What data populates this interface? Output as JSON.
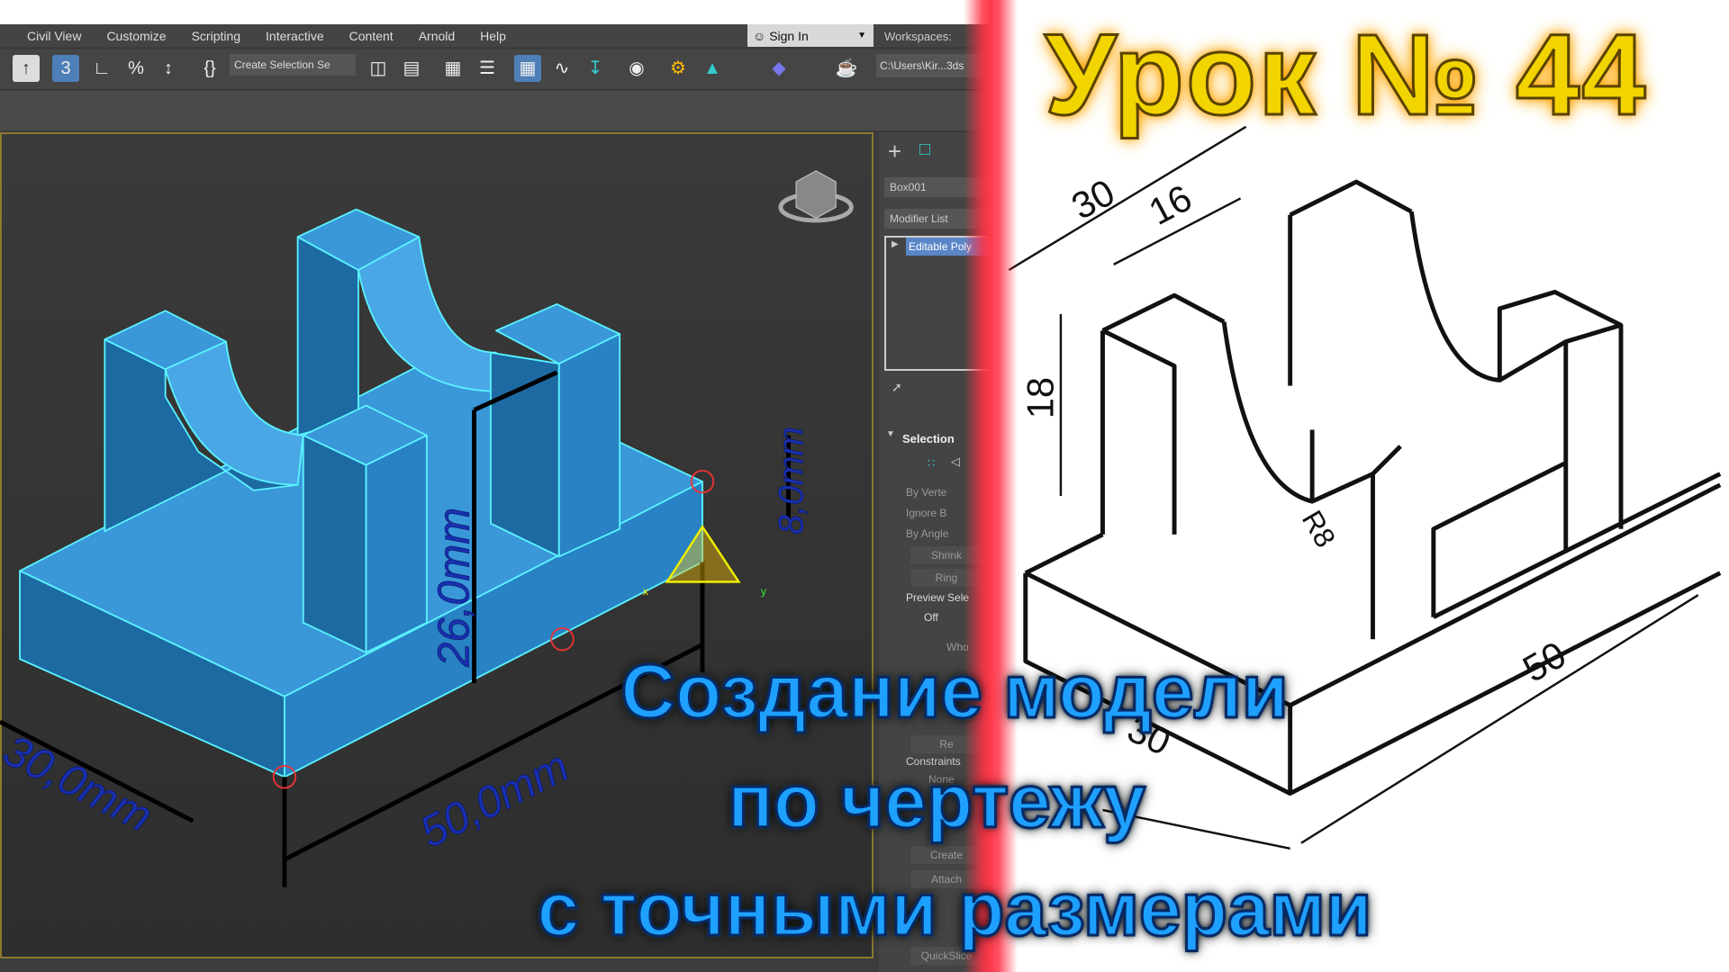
{
  "menu": {
    "items": [
      "Civil View",
      "Customize",
      "Scripting",
      "Interactive",
      "Content",
      "Arnold",
      "Help"
    ],
    "sign_in": "Sign In",
    "workspaces": "Workspaces:"
  },
  "toolbar": {
    "selection_set": "Create Selection Se",
    "path": "C:\\Users\\Kir...3ds"
  },
  "command_panel": {
    "object_name": "Box001",
    "modifier_list": "Modifier List",
    "modifier": "Editable Poly",
    "rollout": "Selection",
    "checkboxes": [
      "By Verte",
      "Ignore B",
      "By Angle"
    ],
    "buttons": [
      "Shrink",
      "Ring"
    ],
    "preview_label": "Preview Sele",
    "preview_value": "Off",
    "whole": "Who",
    "constraints": "Constraints",
    "constraint_value": "None",
    "lower_buttons": [
      "Re",
      "Create",
      "Attach",
      "QuickSlice"
    ]
  },
  "viewport": {
    "dimensions": [
      "26,0mm",
      "8,0mm",
      "50,0mm",
      "30,0mm"
    ],
    "axis_labels": [
      "x",
      "y"
    ]
  },
  "drawing": {
    "dimensions": [
      "30",
      "16",
      "18",
      "R8",
      "50",
      "30"
    ]
  },
  "overlay": {
    "title": "Урок № 44",
    "subtitle_lines": [
      "Создание модели",
      "по чертежу",
      "с точными размерами"
    ]
  },
  "colors": {
    "model_top": "#3a97d8",
    "model_left": "#1d6aa3",
    "model_right": "#2882c4",
    "edge": "#59f2ff",
    "dimension_text": "#1830b0",
    "title": "#f2d400",
    "subtitle": "#1ea0ff",
    "red_glow": "#ff3a4a"
  }
}
